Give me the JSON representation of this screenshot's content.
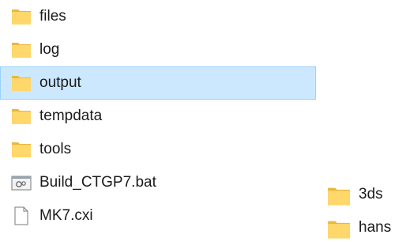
{
  "main_list": {
    "items": [
      {
        "label": "files",
        "icon": "folder-icon",
        "selected": false
      },
      {
        "label": "log",
        "icon": "folder-icon",
        "selected": false
      },
      {
        "label": "output",
        "icon": "folder-icon",
        "selected": true
      },
      {
        "label": "tempdata",
        "icon": "folder-icon",
        "selected": false
      },
      {
        "label": "tools",
        "icon": "folder-icon",
        "selected": false
      },
      {
        "label": "Build_CTGP7.bat",
        "icon": "batch-file-icon",
        "selected": false
      },
      {
        "label": "MK7.cxi",
        "icon": "file-icon",
        "selected": false
      }
    ]
  },
  "side_list": {
    "items": [
      {
        "label": "3ds",
        "icon": "folder-icon"
      },
      {
        "label": "hans",
        "icon": "folder-icon"
      }
    ]
  },
  "colors": {
    "folder": "#ffd76a",
    "folder_dark": "#e8b73f",
    "selection_bg": "#cce8ff",
    "selection_border": "#99d1ff"
  }
}
